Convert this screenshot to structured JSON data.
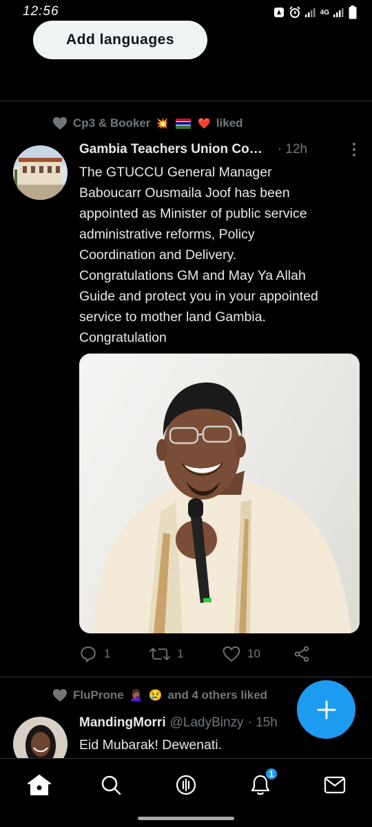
{
  "status_bar": {
    "time": "12:56",
    "network": "4G"
  },
  "top": {
    "add_languages_label": "Add languages"
  },
  "tweets": [
    {
      "social_context": {
        "text_before": "Cp3 & Booker",
        "emoji_1": "💥",
        "emoji_2": "❤️",
        "text_after": "liked"
      },
      "author_name": "Gambia Teachers Union Co…",
      "time": "· 12h",
      "text_lines": [
        "The GTUCCU General Manager",
        "Baboucarr Ousmaila Joof has been",
        "appointed as Minister of public service",
        "administrative reforms, Policy",
        "Coordination and Delivery.",
        "Congratulations GM and May Ya Allah",
        "Guide and protect you in your appointed",
        "service to mother land Gambia.",
        "Congratulation"
      ],
      "replies": "1",
      "retweets": "1",
      "likes": "10"
    },
    {
      "social_context": {
        "text_before": "FluProne",
        "emoji_1": "🤦🏾‍♀️",
        "emoji_2": "😢",
        "text_after": "and 4 others liked"
      },
      "author_name": "MandingMorri",
      "handle": "@LadyBinzy",
      "time": "· 15h",
      "text": "Eid Mubarak! Dewenati."
    }
  ],
  "nav": {
    "items": [
      "home",
      "search",
      "spaces",
      "notifications",
      "messages"
    ],
    "notification_count": "1"
  },
  "colors": {
    "accent": "#1d9bf0",
    "background": "#000000",
    "muted": "#71767b"
  }
}
